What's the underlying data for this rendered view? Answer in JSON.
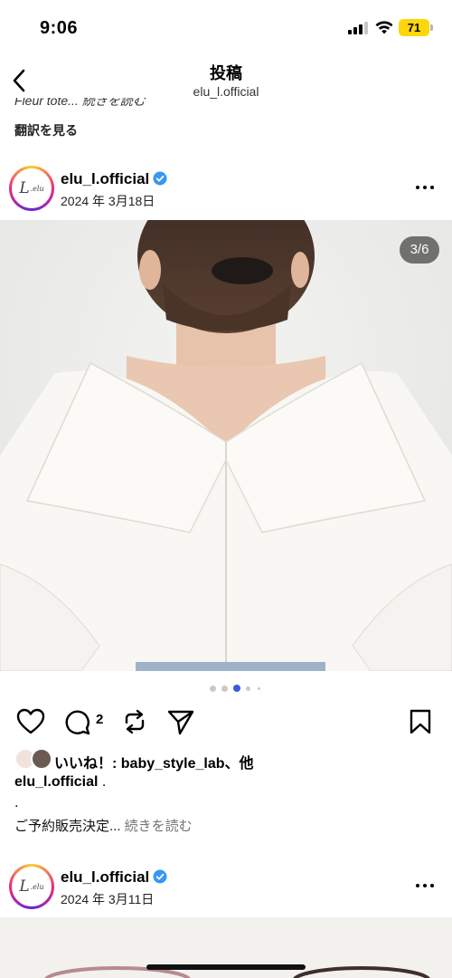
{
  "status_bar": {
    "time": "9:06",
    "battery": "71"
  },
  "header": {
    "title": "投稿",
    "subtitle": "elu_l.official"
  },
  "previous_post": {
    "caption_fragment": "Fleur tote... 続きを読む",
    "translate_label": "翻訳を見る"
  },
  "post": {
    "username": "elu_l.official",
    "date": "2024 年 3月18日",
    "avatar_text": "L.elu",
    "image_counter": "3/6",
    "carousel": {
      "count": 5,
      "active_index": 2
    },
    "comment_count": "2",
    "likes_text": "いいね！: baby_style_lab、他",
    "caption_username": "elu_l.official",
    "caption_username_suffix": " .",
    "caption_dot": ".",
    "caption_text": "ご予約販売決定... ",
    "caption_more": "続きを読む"
  },
  "next_post": {
    "username": "elu_l.official",
    "date": "2024 年 3月11日",
    "avatar_text": "L.elu"
  },
  "colors": {
    "verified": "#3897f0",
    "battery": "#ffd60a",
    "active_dot": "#3b5bdb"
  },
  "icons": [
    "back-chevron-icon",
    "verified-badge-icon",
    "more-dots-icon",
    "heart-icon",
    "comment-icon",
    "repost-icon",
    "share-icon",
    "bookmark-icon"
  ]
}
